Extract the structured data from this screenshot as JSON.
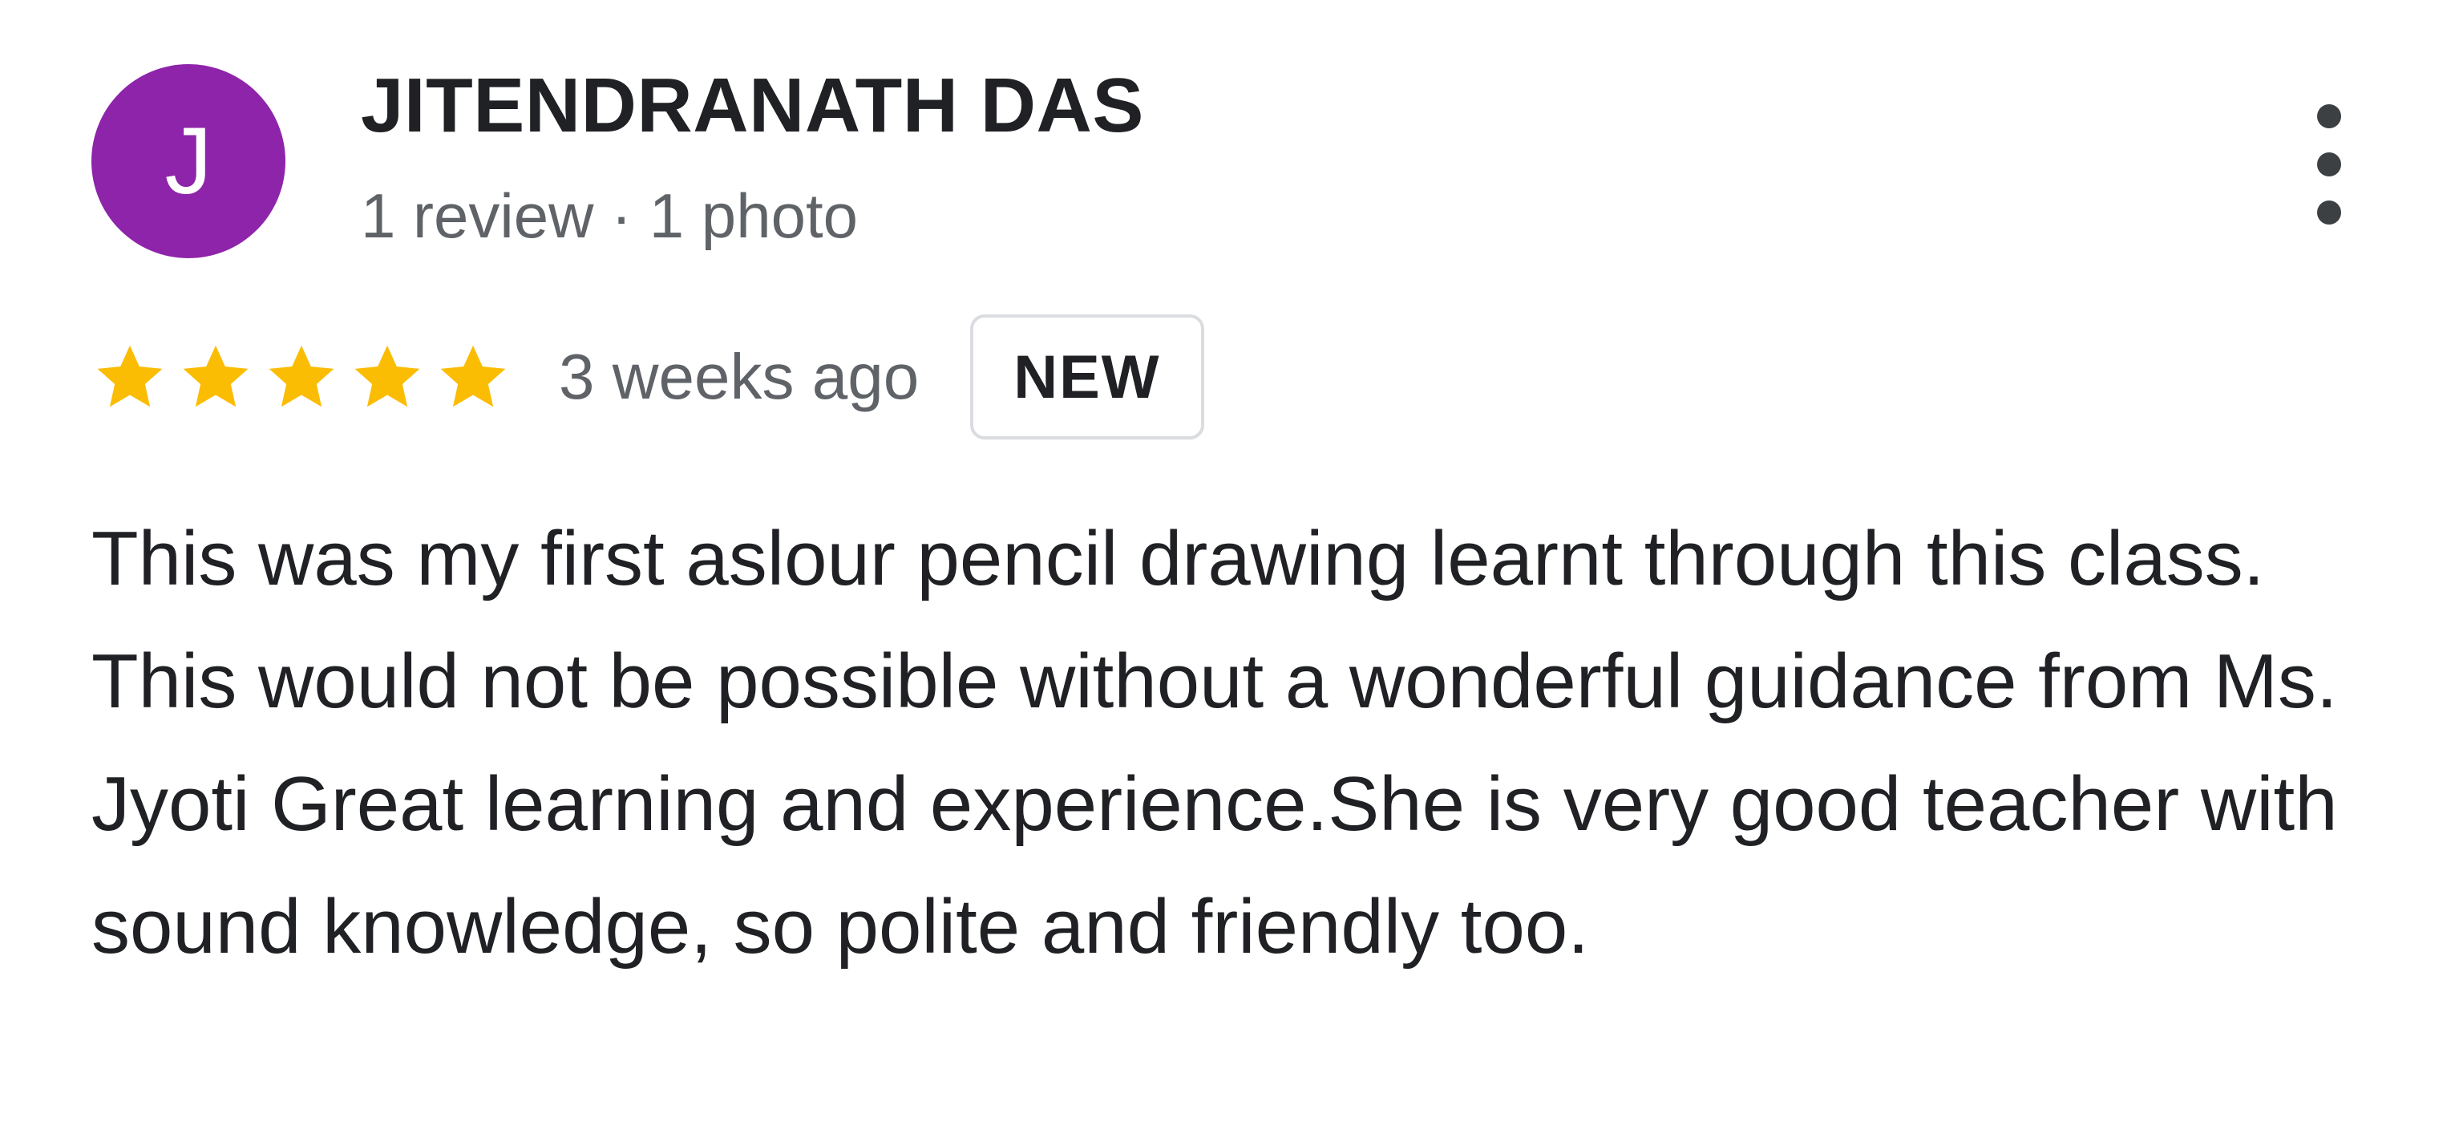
{
  "review": {
    "author": {
      "initial": "J",
      "name": "JITENDRANATH DAS",
      "meta": "1 review · 1 photo",
      "avatar_color": "#8e24aa"
    },
    "rating": {
      "stars": 5,
      "max_stars": 5,
      "star_color": "#fbbc04",
      "icon": "star-icon"
    },
    "time": "3 weeks ago",
    "badge": "NEW",
    "text": "This was my first aslour pencil drawing learnt through this class. This would not be possible without a wonderful guidance from Ms. Jyoti Great learning and experience.She is very good teacher with sound knowledge, so polite and friendly too.",
    "more_icon": "more-vertical-icon"
  }
}
